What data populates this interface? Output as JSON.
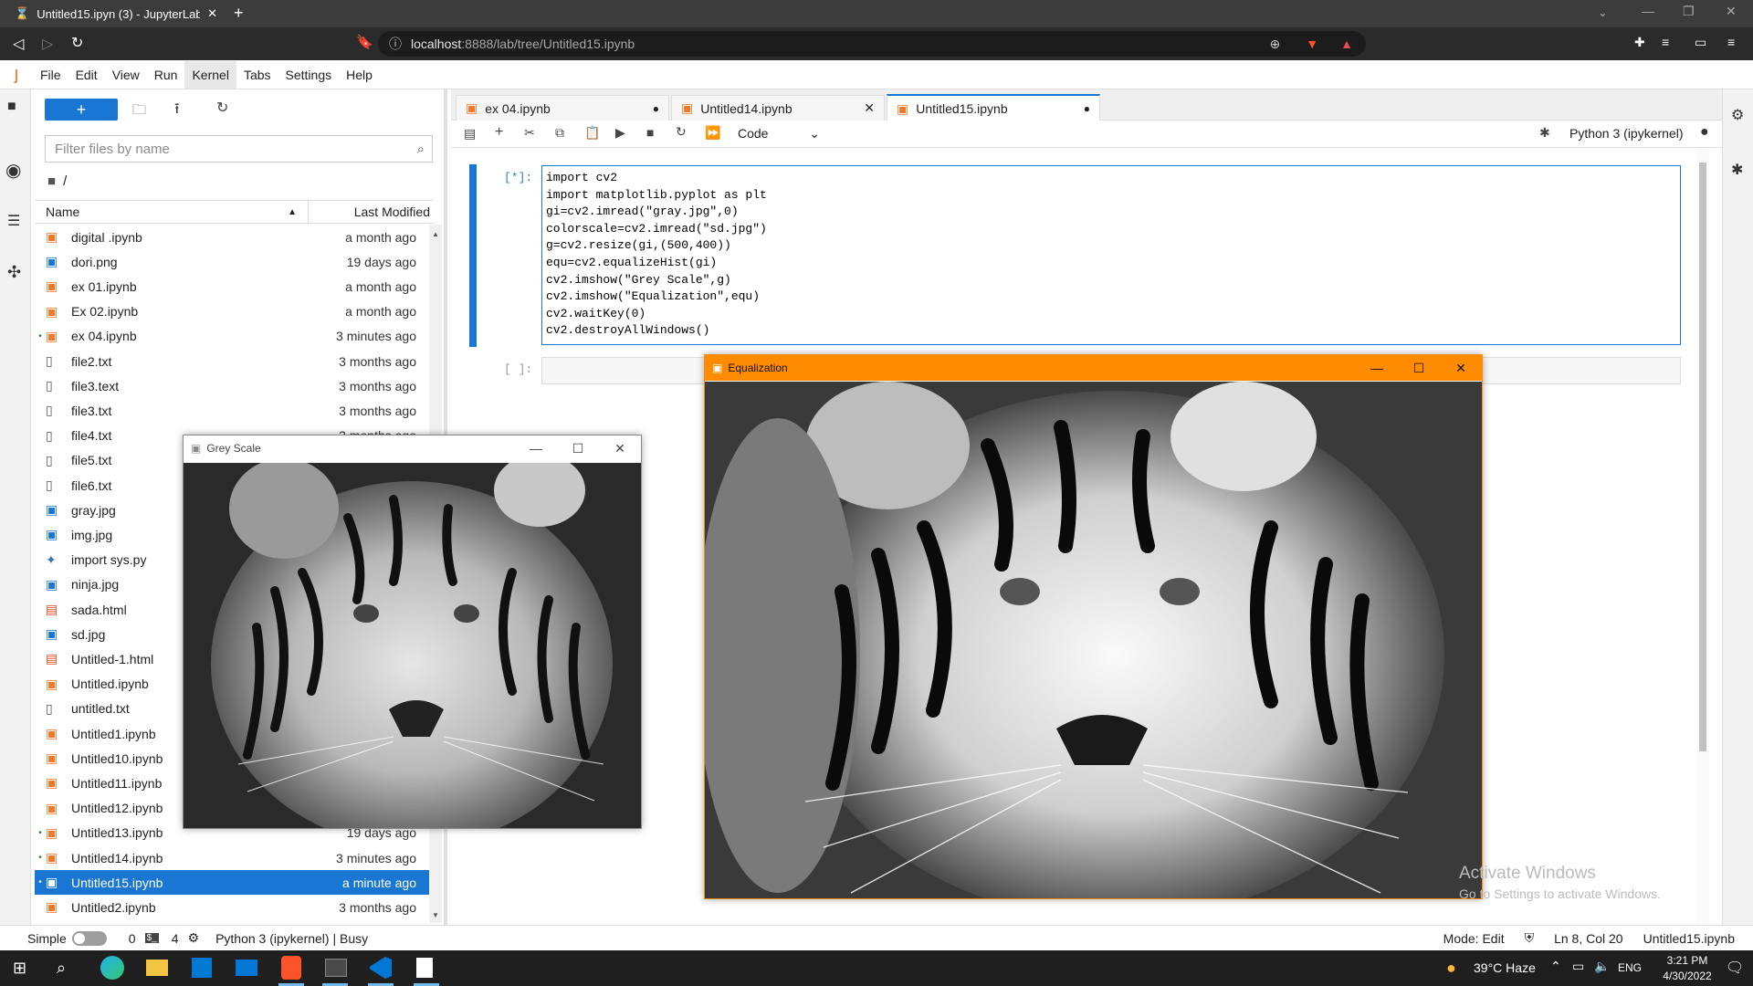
{
  "browser": {
    "tab_title": "Untitled15.ipyn (3) - JupyterLab",
    "url_host": "localhost",
    "url_rest": ":8888/lab/tree/Untitled15.ipynb"
  },
  "menu": [
    "File",
    "Edit",
    "View",
    "Run",
    "Kernel",
    "Tabs",
    "Settings",
    "Help"
  ],
  "filebrowser": {
    "filter_placeholder": "Filter files by name",
    "path": "/",
    "col_name": "Name",
    "col_modified": "Last Modified",
    "files": [
      {
        "name": "digital .ipynb",
        "modified": "a month ago",
        "type": "notebook",
        "running": false
      },
      {
        "name": "dori.png",
        "modified": "19 days ago",
        "type": "image",
        "running": false
      },
      {
        "name": "ex 01.ipynb",
        "modified": "a month ago",
        "type": "notebook",
        "running": false
      },
      {
        "name": "Ex 02.ipynb",
        "modified": "a month ago",
        "type": "notebook",
        "running": false
      },
      {
        "name": "ex 04.ipynb",
        "modified": "3 minutes ago",
        "type": "notebook",
        "running": true
      },
      {
        "name": "file2.txt",
        "modified": "3 months ago",
        "type": "text",
        "running": false
      },
      {
        "name": "file3.text",
        "modified": "3 months ago",
        "type": "text",
        "running": false
      },
      {
        "name": "file3.txt",
        "modified": "3 months ago",
        "type": "text",
        "running": false
      },
      {
        "name": "file4.txt",
        "modified": "3 months ago",
        "type": "text",
        "running": false
      },
      {
        "name": "file5.txt",
        "modified": "",
        "type": "text",
        "running": false
      },
      {
        "name": "file6.txt",
        "modified": "",
        "type": "text",
        "running": false
      },
      {
        "name": "gray.jpg",
        "modified": "",
        "type": "image",
        "running": false
      },
      {
        "name": "img.jpg",
        "modified": "",
        "type": "image",
        "running": false
      },
      {
        "name": "import sys.py",
        "modified": "",
        "type": "python",
        "running": false
      },
      {
        "name": "ninja.jpg",
        "modified": "",
        "type": "image",
        "running": false
      },
      {
        "name": "sada.html",
        "modified": "",
        "type": "html",
        "running": false
      },
      {
        "name": "sd.jpg",
        "modified": "",
        "type": "image",
        "running": false
      },
      {
        "name": "Untitled-1.html",
        "modified": "",
        "type": "html",
        "running": false
      },
      {
        "name": "Untitled.ipynb",
        "modified": "",
        "type": "notebook",
        "running": false
      },
      {
        "name": "untitled.txt",
        "modified": "",
        "type": "text",
        "running": false
      },
      {
        "name": "Untitled1.ipynb",
        "modified": "",
        "type": "notebook",
        "running": false
      },
      {
        "name": "Untitled10.ipynb",
        "modified": "",
        "type": "notebook",
        "running": false
      },
      {
        "name": "Untitled11.ipynb",
        "modified": "",
        "type": "notebook",
        "running": false
      },
      {
        "name": "Untitled12.ipynb",
        "modified": "",
        "type": "notebook",
        "running": false
      },
      {
        "name": "Untitled13.ipynb",
        "modified": "19 days ago",
        "type": "notebook",
        "running": true
      },
      {
        "name": "Untitled14.ipynb",
        "modified": "3 minutes ago",
        "type": "notebook",
        "running": true
      },
      {
        "name": "Untitled15.ipynb",
        "modified": "a minute ago",
        "type": "notebook",
        "running": true,
        "selected": true
      },
      {
        "name": "Untitled2.ipynb",
        "modified": "3 months ago",
        "type": "notebook",
        "running": false
      }
    ]
  },
  "notebook": {
    "tabs": [
      {
        "label": "ex 04.ipynb",
        "state": "dirty"
      },
      {
        "label": "Untitled14.ipynb",
        "state": "close"
      },
      {
        "label": "Untitled15.ipynb",
        "state": "dirty",
        "active": true
      }
    ],
    "celltype": "Code",
    "kernel": "Python 3 (ipykernel)",
    "cell1_prompt": "[*]:",
    "cell2_prompt": "[ ]:",
    "code_lines": [
      "import cv2",
      "import matplotlib.pyplot as plt",
      "gi=cv2.imread(\"gray.jpg\",0)",
      "colorscale=cv2.imread(\"sd.jpg\")",
      "g=cv2.resize(gi,(500,400))",
      "equ=cv2.equalizeHist(gi)",
      "cv2.imshow(\"Grey Scale\",g)",
      "cv2.imshow(\"Equalization\",equ)",
      "cv2.waitKey(0)",
      "cv2.destroyAllWindows()"
    ]
  },
  "windows": {
    "grey_title": "Grey Scale",
    "equal_title": "Equalization"
  },
  "watermark": {
    "line1": "Activate Windows",
    "line2": "Go to Settings to activate Windows."
  },
  "statusbar": {
    "simple": "Simple",
    "count0": "0",
    "count4": "4",
    "kernel_status": "Python 3 (ipykernel) | Busy",
    "mode": "Mode: Edit",
    "position": "Ln 8, Col 20",
    "filename": "Untitled15.ipynb"
  },
  "taskbar": {
    "weather": "39°C  Haze",
    "lang": "ENG",
    "time": "3:21 PM",
    "date": "4/30/2022"
  },
  "colors": {
    "accent": "#1976d2",
    "orange_title": "#ff8c00",
    "running_dot": "#2e7d32"
  }
}
